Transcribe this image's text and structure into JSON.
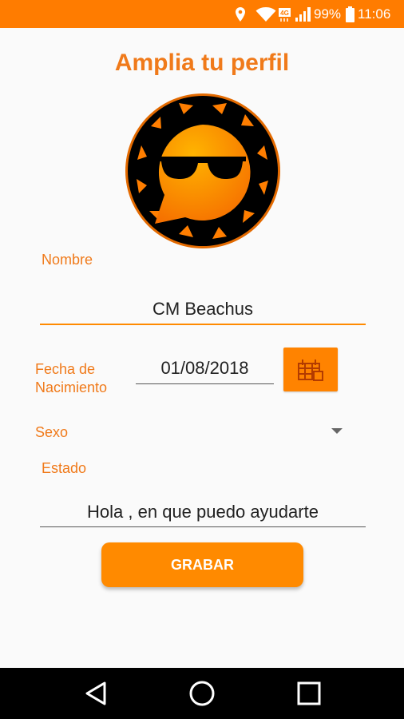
{
  "status_bar": {
    "battery": "99%",
    "time": "11:06",
    "network_badge": "4G"
  },
  "title": "Amplia tu perfil",
  "form": {
    "nombre_label": "Nombre",
    "nombre_value": "CM Beachus",
    "fecha_label_line1": "Fecha de",
    "fecha_label_line2": "Nacimiento",
    "fecha_value": "01/08/2018",
    "sexo_label": "Sexo",
    "estado_label": "Estado",
    "estado_value": "Hola , en que puedo ayudarte",
    "save_label": "GRABAR"
  },
  "colors": {
    "accent": "#ff7c00",
    "label": "#f07a1a",
    "button": "#ff8a00"
  },
  "icons": {
    "location": "location-icon",
    "wifi": "wifi-icon",
    "signal": "signal-icon",
    "battery": "battery-icon",
    "calendar": "calendar-icon",
    "back": "back-icon",
    "home": "home-icon",
    "recents": "recents-icon"
  }
}
